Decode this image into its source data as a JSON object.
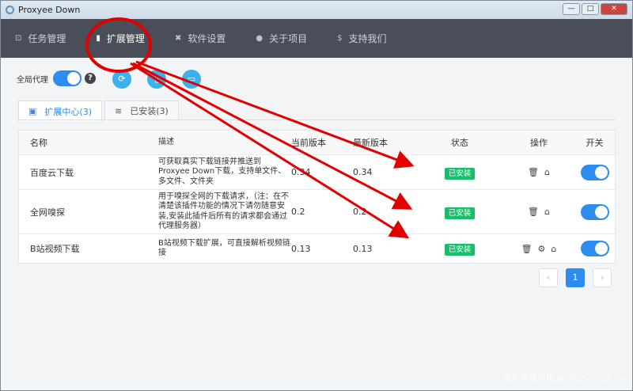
{
  "window": {
    "title": "Proxyee Down",
    "minimize": "—",
    "maximize": "□",
    "close": "✕"
  },
  "nav": [
    {
      "label": "任务管理",
      "icon": "task-icon"
    },
    {
      "label": "扩展管理",
      "icon": "extension-icon",
      "active": true
    },
    {
      "label": "软件设置",
      "icon": "wrench-icon"
    },
    {
      "label": "关于项目",
      "icon": "info-icon"
    },
    {
      "label": "支持我们",
      "icon": "dollar-icon"
    }
  ],
  "toolbar": {
    "proxy_label": "全局代理",
    "proxy_on": true,
    "help": "?"
  },
  "tabs": [
    {
      "label": "扩展中心(3)",
      "active": true
    },
    {
      "label": "已安装(3)"
    }
  ],
  "table": {
    "columns": [
      "名称",
      "描述",
      "当前版本",
      "最新版本",
      "状态",
      "操作",
      "开关"
    ],
    "rows": [
      {
        "name": "百度云下载",
        "desc": "可获取真实下载链接并推送到Proxyee Down下载，支持单文件、多文件、文件夹",
        "current": "0.34",
        "latest": "0.34",
        "status": "已安装",
        "ops": [
          "delete",
          "home"
        ],
        "enabled": true
      },
      {
        "name": "全网嗅探",
        "desc": "用于嗅探全网的下载请求，（注：在不清楚该插件功能的情况下请勿随意安装,安装此插件后所有的请求都会通过代理服务器）",
        "current": "0.2",
        "latest": "0.2",
        "status": "已安装",
        "ops": [
          "delete",
          "home"
        ],
        "enabled": true
      },
      {
        "name": "B站视频下载",
        "desc": "B站视频下载扩展，可直接解析视频链接",
        "current": "0.13",
        "latest": "0.13",
        "status": "已安装",
        "ops": [
          "delete",
          "settings",
          "home"
        ],
        "enabled": true
      }
    ]
  },
  "pagination": {
    "prev": "‹",
    "current": "1",
    "next": "›"
  },
  "watermark": "吾爱破解论坛 www.52pojie.cn",
  "colors": {
    "nav_bg": "#494e58",
    "primary": "#2d8cf0",
    "installed": "#19be6b",
    "annotation": "#e00000"
  }
}
